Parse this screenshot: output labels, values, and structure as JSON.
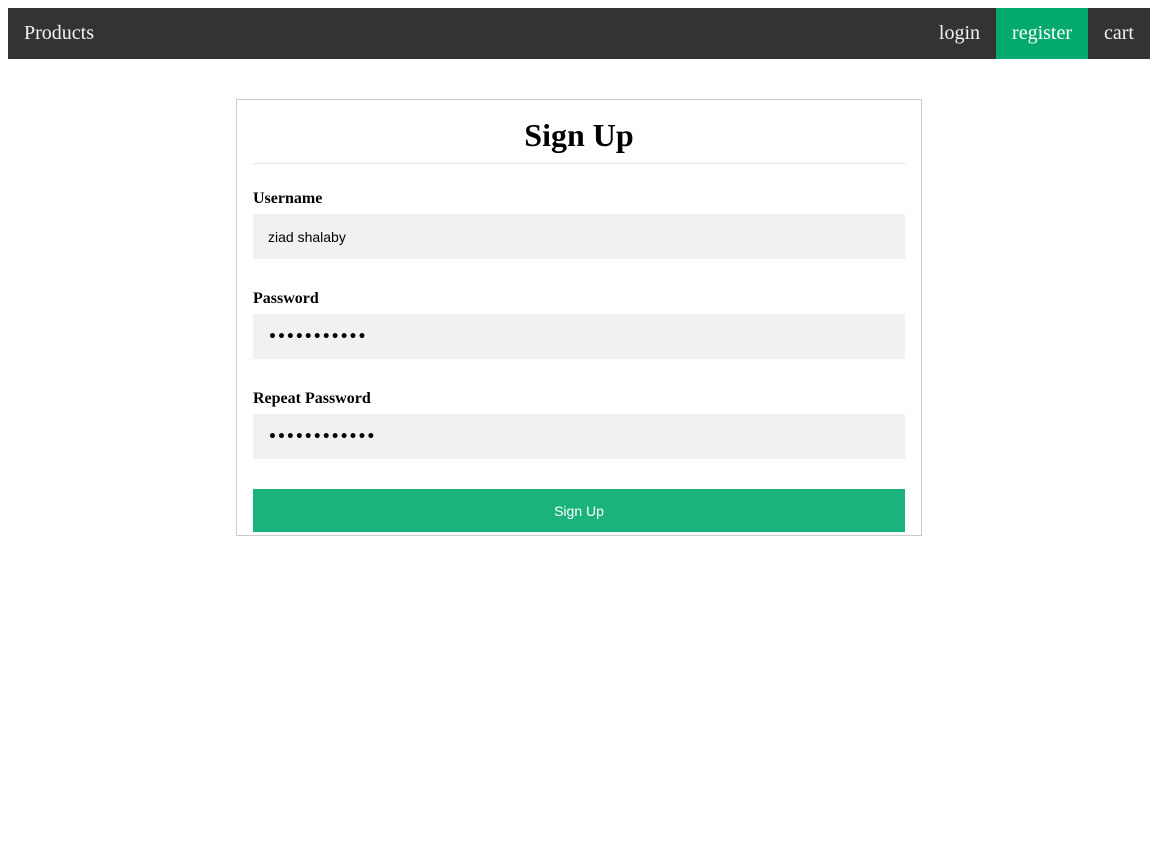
{
  "nav": {
    "brand": "Products",
    "links": [
      {
        "label": "login"
      },
      {
        "label": "register",
        "active": true
      },
      {
        "label": "cart"
      }
    ],
    "bg_color": "#333333",
    "active_color": "#04AA6D"
  },
  "form": {
    "title": "Sign Up",
    "username_label": "Username",
    "username_value": "ziad shalaby",
    "password_label": "Password",
    "password_value": "•••••••••••",
    "repeat_label": "Repeat Password",
    "repeat_value": "••••••••••••",
    "submit_label": "Sign Up",
    "submit_color": "#1ab37b"
  }
}
